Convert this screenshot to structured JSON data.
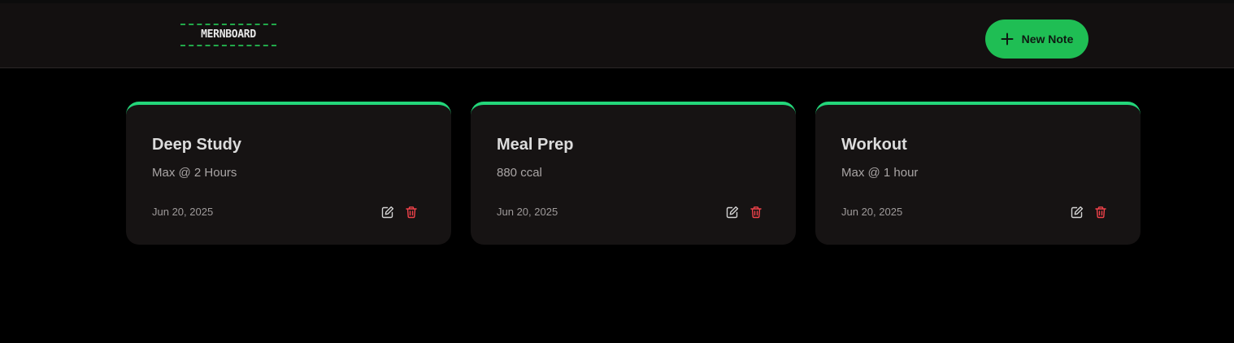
{
  "header": {
    "logo_text": "MERNBOARD",
    "new_note_label": "New Note",
    "accent_color": "#1fbe54"
  },
  "notes": [
    {
      "title": "Deep Study",
      "content": "Max @ 2 Hours",
      "date": "Jun 20, 2025"
    },
    {
      "title": "Meal Prep",
      "content": "880 ccal",
      "date": "Jun 20, 2025"
    },
    {
      "title": "Workout",
      "content": "Max @ 1 hour",
      "date": "Jun 20, 2025"
    }
  ],
  "icons": {
    "new_note": "plus-icon",
    "edit": "edit-icon",
    "delete": "trash-icon"
  },
  "colors": {
    "card_border_top": "#23d67a",
    "delete_icon": "#f0424a",
    "background": "#000000"
  }
}
